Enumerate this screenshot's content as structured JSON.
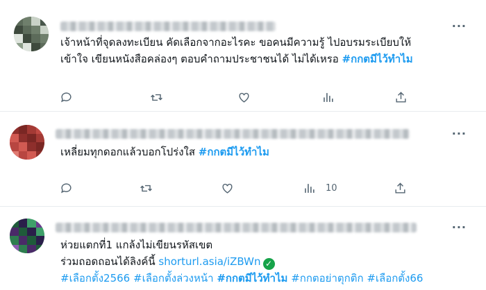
{
  "tweets": [
    {
      "text_lines": [
        {
          "plain": "เจ้าหน้าที่จุดลงทะเบียน คัดเลือกจากอะไรคะ ขอคนมีความรู้  ไปอบรมระเบียบให้"
        },
        {
          "plain": "เข้าใจ เขียนหนังสือคล่องๆ  ตอบคำถามประชาชนได้  ไม่ได้เหรอ ",
          "hashtag": "#กกตมีไว้ทำไม"
        }
      ],
      "views": ""
    },
    {
      "text_lines": [
        {
          "plain": "เหลี่ยมทุกดอกแล้วบอกโปร่งใส ",
          "hashtag": "#กกตมีไว้ทำไม"
        }
      ],
      "views": "10"
    },
    {
      "line1": "ห่วยแตกที่1 แกล้งไม่เขียนรหัสเขต",
      "line2_plain": "ร่วมถอดถอนได้ลิงค์นี้ ",
      "link": "shorturl.asia/iZBWn",
      "hashtags": [
        "#เลือกตั้ง2566",
        "#เลือกตั้งล่วงหน้า",
        "#กกตมีไว้ทำไม",
        "#กกตอย่าตุกติก",
        "#เลือกตั้ง66"
      ]
    }
  ],
  "icons": [
    "reply-icon",
    "retweet-icon",
    "like-icon",
    "views-icon",
    "share-icon",
    "more-icon",
    "verified-check-icon"
  ],
  "colors": {
    "accent": "#1d9bf0",
    "muted": "#536471",
    "check": "#17a34a"
  }
}
